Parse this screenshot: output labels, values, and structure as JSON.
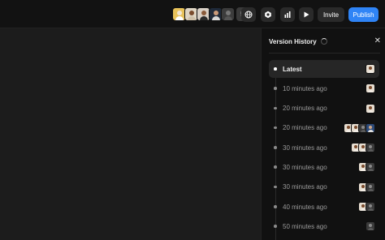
{
  "toolbar": {
    "collaborator_count": "54",
    "invite_label": "Invite",
    "publish_label": "Publish",
    "buttons": [
      "globe-icon",
      "hexagon-icon",
      "bar-chart-icon",
      "play-icon"
    ]
  },
  "colors": {
    "accent": "#2f84f6",
    "avatar_bg": [
      "#e8c25a",
      "#e0d6c4",
      "#d9d0c6",
      "#3c3c3c"
    ]
  },
  "panel": {
    "title": "Version History",
    "close_icon": "close-icon",
    "versions": [
      {
        "label": "Latest",
        "active": true,
        "avatars": [
          "woman"
        ]
      },
      {
        "label": "10 minutes ago",
        "avatars": [
          "woman"
        ]
      },
      {
        "label": "20 minutes ago",
        "avatars": [
          "woman"
        ]
      },
      {
        "label": "20 minutes ago",
        "avatars": [
          "woman",
          "woman",
          "dark",
          "blue"
        ]
      },
      {
        "label": "30 minutes ago",
        "avatars": [
          "woman",
          "woman",
          "dark"
        ]
      },
      {
        "label": "30 minutes ago",
        "avatars": [
          "woman",
          "dark"
        ]
      },
      {
        "label": "30 minutes ago",
        "avatars": [
          "woman",
          "dark"
        ]
      },
      {
        "label": "40 minutes ago",
        "avatars": [
          "woman",
          "dark"
        ]
      },
      {
        "label": "50 minutes ago",
        "avatars": [
          "dark"
        ]
      }
    ]
  }
}
